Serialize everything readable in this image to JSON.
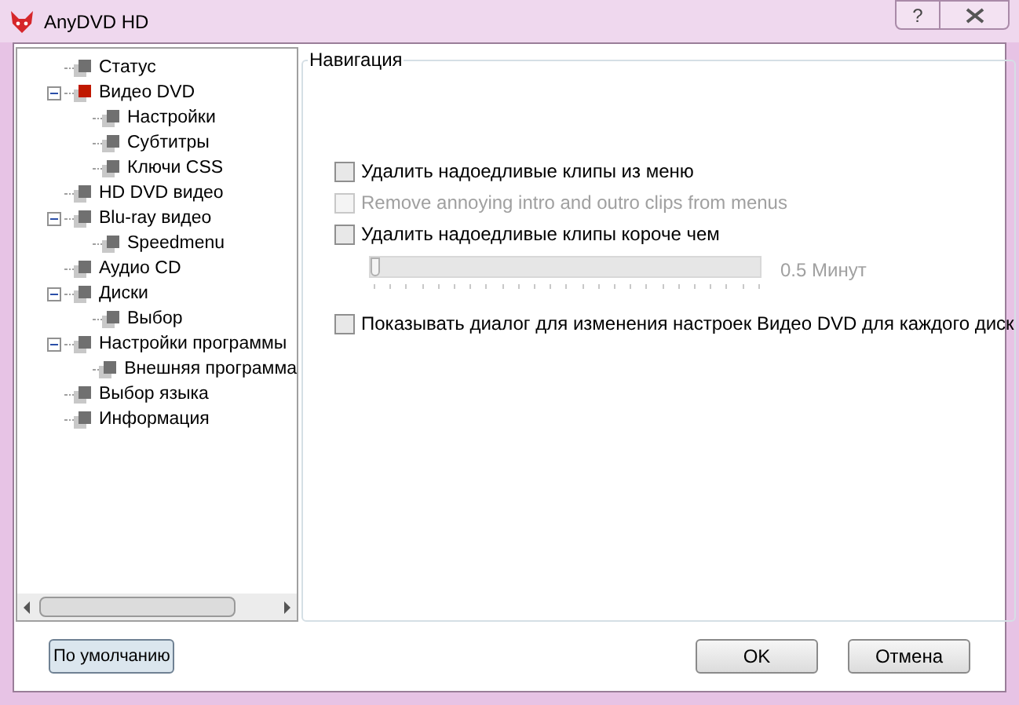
{
  "window": {
    "title": "AnyDVD HD",
    "help": "?"
  },
  "tree": [
    {
      "label": "Статус",
      "selected": false
    },
    {
      "label": "Видео DVD",
      "selected": true,
      "expanded": true,
      "children": [
        {
          "label": "Настройки",
          "selected": false
        },
        {
          "label": "Субтитры",
          "selected": false
        },
        {
          "label": "Ключи CSS",
          "selected": false
        }
      ]
    },
    {
      "label": "HD DVD видео",
      "selected": false
    },
    {
      "label": "Blu-ray видео",
      "selected": false,
      "expanded": true,
      "children": [
        {
          "label": "Speedmenu",
          "selected": false
        }
      ]
    },
    {
      "label": "Аудио CD",
      "selected": false
    },
    {
      "label": "Диски",
      "selected": false,
      "expanded": true,
      "children": [
        {
          "label": "Выбор",
          "selected": false
        }
      ]
    },
    {
      "label": "Настройки программы",
      "selected": false,
      "expanded": true,
      "children": [
        {
          "label": "Внешняя программа",
          "selected": false
        }
      ]
    },
    {
      "label": "Выбор языка",
      "selected": false
    },
    {
      "label": "Информация",
      "selected": false
    }
  ],
  "group": {
    "title": "Навигация",
    "options": [
      {
        "kind": "checkbox",
        "label": "Удалить надоедливые клипы из меню",
        "checked": false,
        "disabled": false
      },
      {
        "kind": "checkbox",
        "label": "Remove annoying intro and outro clips from menus",
        "checked": false,
        "disabled": true
      },
      {
        "kind": "checkbox",
        "label": "Удалить надоедливые клипы короче чем",
        "checked": false,
        "disabled": false
      },
      {
        "kind": "slider",
        "level": 0,
        "reading": "0.5 Минут",
        "disabled": true
      },
      {
        "kind": "checkbox",
        "label": "Показывать диалог для изменения настроек Видео DVD для каждого диск",
        "checked": false,
        "disabled": false
      }
    ]
  },
  "buttons": {
    "defaults": "По умолчанию",
    "ok": "OK",
    "cancel": "Отмена"
  }
}
